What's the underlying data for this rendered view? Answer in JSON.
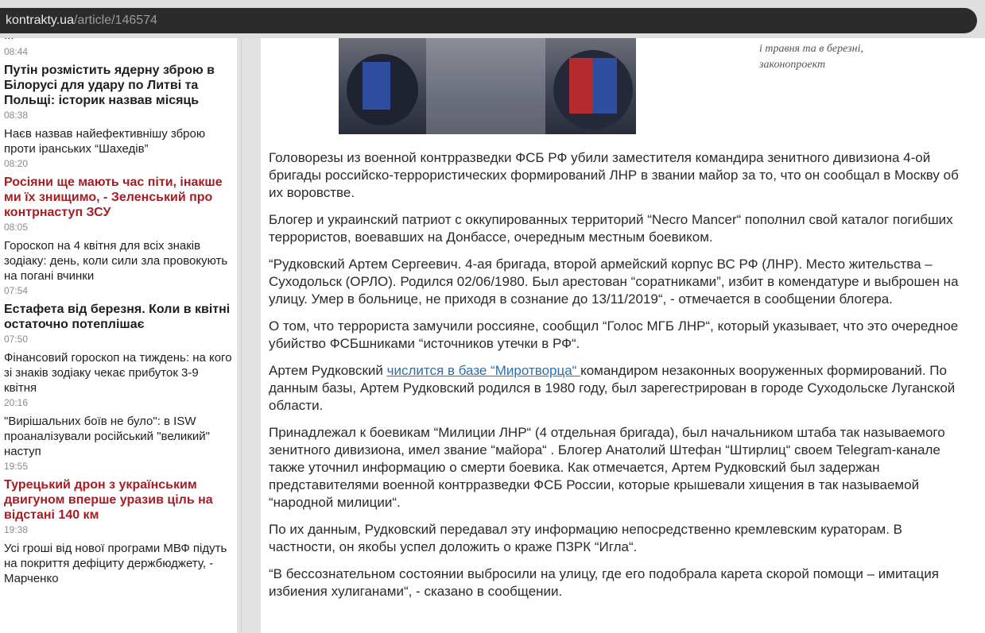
{
  "browser": {
    "url_domain": "kontrakty.ua",
    "url_path": "/article/146574"
  },
  "sidebar": {
    "cut_text": "...",
    "items": [
      {
        "time": "08:44",
        "title": "Путін розмістить ядерну зброю в Білорусі для удару по Литві та Польщі: історик назвав місяць",
        "style": "bold"
      },
      {
        "time": "08:38",
        "title": "Наєв назвав найефективнішу зброю проти іранських “Шахедів”",
        "style": "normal"
      },
      {
        "time": "08:20",
        "title": "Росіяни ще мають час піти, інакше ми їх знищимо, - Зеленський про контрнаступ ЗСУ",
        "style": "red"
      },
      {
        "time": "08:05",
        "title": "Гороскоп на 4 квітня для всіх знаків зодіаку: день, коли сили зла провокують на погані вчинки",
        "style": "normal"
      },
      {
        "time": "07:54",
        "title": "Естафета від березня. Коли в квітні остаточно потеплішає",
        "style": "bold"
      },
      {
        "time": "07:50",
        "title": "Фінансовий гороскоп на тиждень: на кого зі знаків зодіаку чекає прибуток 3-9 квітня",
        "style": "normal"
      },
      {
        "time": "20:16",
        "title": "\"Вирішальних боїв не було\": в ISW проаналізували російський \"великий\" наступ",
        "style": "normal"
      },
      {
        "time": "19:55",
        "title": "Турецький дрон з українським двигуном вперше уразив ціль на відстані 140 км",
        "style": "red"
      },
      {
        "time": "19:38",
        "title": "Усі гроші від нової програми МВФ підуть на покриття дефіциту держбюджету, - Марченко",
        "style": "normal"
      }
    ]
  },
  "side_caption": {
    "line1": "і травня та в березні,",
    "line2": "законопроект"
  },
  "article": {
    "p1": "Головорезы из военной контрразведки ФСБ РФ убили заместителя командира зенитного дивизиона 4-ой бригады российско-террористических формирований ЛНР в звании майор за то, что он сообщал в Москву об их воровстве.",
    "p2": "Блогер и украинский патриот с оккупированных территорий “Necro Mancer“ пополнил свой каталог погибших террористов, воевавших на Донбассе, очередным местным боевиком.",
    "p3": "“Рудковский Артем Сергеевич. 4-ая бригада, второй армейский корпус ВС РФ (ЛНР). Место жительства – Суходольск (ОРЛО). Родился 02/06/1980. Был арестован “соратниками”, избит в комендатуре и выброшен на улицу. Умер в больнице, не приходя в сознание до 13/11/2019“, - отмечается в сообщении блогера.",
    "p4": "О том, что террориста замучили россияне, сообщил “Голос МГБ ЛНР“, который указывает, что это очередное убийство ФСБшниками “источников утечки в РФ“.",
    "p5_before": "Артем Рудковский ",
    "p5_link": "числится в базе “Миротворца“ ",
    "p5_after": "командиром незаконных вооруженных формирований. По данным базы, Артем Рудковский родился в 1980 году, был зарегестрирован в городе Суходольске Луганской области.",
    "p6": "Принадлежал к боевикам “Милиции ЛНР“ (4 отдельная бригада), был начальником штаба так называемого зенитного дивизиона, имел звание “майора“ . Блогер Анатолий Штефан “Штирлиц“ своем Telegram-канале  также уточнил информацию о смерти боевика. Как отмечается, Артем Рудковский был задержан представителями военной контрразведки ФСБ России, которые крышевали хищения в так называемой “народной милиции“.",
    "p7": "По их данным, Рудковский передавал эту информацию непосредственно кремлевским кураторам. В частности, он якобы успел доложить о краже ПЗРК “Игла“.",
    "p8": "“В бессознательном состоянии выбросили на улицу, где его подобрала карета скорой помощи – имитация избиения хулиганами“, - сказано в сообщении."
  }
}
